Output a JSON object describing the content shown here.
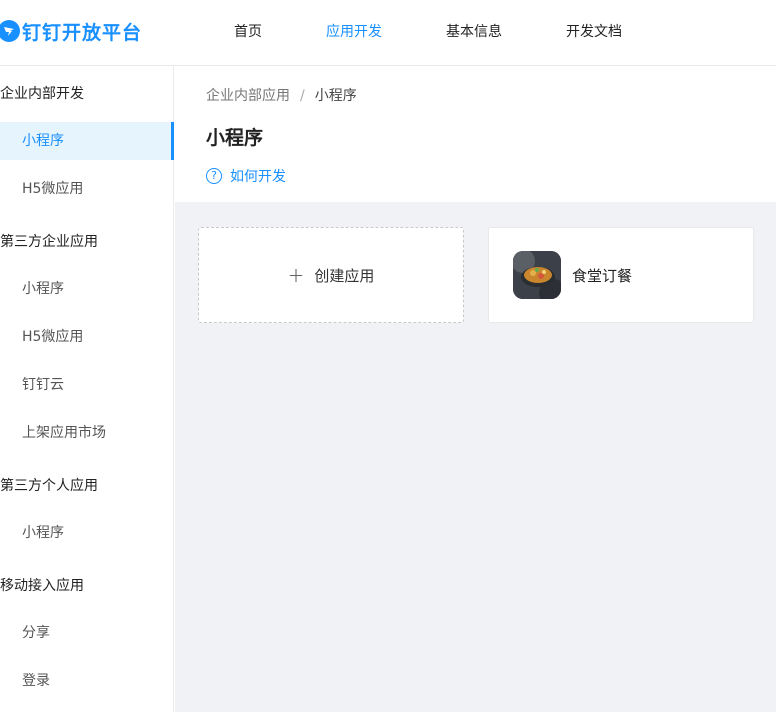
{
  "header": {
    "logo_text": "钉钉开放平台",
    "nav": [
      {
        "label": "首页",
        "active": false
      },
      {
        "label": "应用开发",
        "active": true
      },
      {
        "label": "基本信息",
        "active": false
      },
      {
        "label": "开发文档",
        "active": false
      }
    ]
  },
  "sidebar": {
    "groups": [
      {
        "label": "企业内部开发",
        "items": [
          "小程序",
          "H5微应用"
        ]
      },
      {
        "label": "第三方企业应用",
        "items": [
          "小程序",
          "H5微应用",
          "钉钉云",
          "上架应用市场"
        ]
      },
      {
        "label": "第三方个人应用",
        "items": [
          "小程序"
        ]
      },
      {
        "label": "移动接入应用",
        "items": [
          "分享",
          "登录"
        ]
      }
    ],
    "active_item": "企业内部开发/小程序"
  },
  "main": {
    "breadcrumb": {
      "parent": "企业内部应用",
      "separator": "/",
      "current": "小程序"
    },
    "title": "小程序",
    "help_link": "如何开发",
    "create_card": {
      "icon": "plus-icon",
      "label": "创建应用"
    },
    "apps": [
      {
        "name": "食堂订餐",
        "icon": "app-thumbnail"
      }
    ]
  },
  "colors": {
    "accent": "#1890ff",
    "bg": "#f0f2f5",
    "active_bg": "#e6f4fd"
  }
}
